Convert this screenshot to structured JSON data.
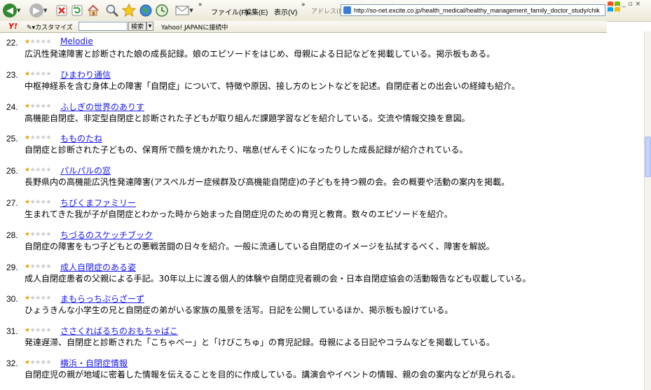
{
  "browser": {
    "menu": [
      "ファイル(F)",
      "編集(E)",
      "表示(V)"
    ],
    "address_label": "アドレス(D)",
    "url": "http://so-net.excite.co.jp/health_medical/healthy_management_family_doctor_study/chik",
    "colors": {
      "back": "#2f8a2f",
      "forward": "#b7b7b7",
      "accent": "#1a1ae6"
    }
  },
  "yahoo_bar": {
    "logo": "Y!",
    "customize": "カスタマイズ",
    "search_button": "検索",
    "connect_text": "Yahoo! JAPANに接続中"
  },
  "entries": [
    {
      "num": "22.",
      "rating": 1,
      "title": "Melodie",
      "desc": "広汎性発達障害と診断された娘の成長記録。娘のエピソードをはじめ、母親による日記などを掲載している。掲示板もある。"
    },
    {
      "num": "23.",
      "rating": 1,
      "title": "ひまわり通信",
      "desc": "中枢神経系を含む身体上の障害「自閉症」について、特徴や原因、接し方のヒントなどを記述。自閉症者との出会いの経緯も紹介。"
    },
    {
      "num": "24.",
      "rating": 1,
      "title": "ふしぎの世界のありす",
      "desc": "高機能自閉症、非定型自閉症と診断された子どもが取り組んだ課題学習などを紹介している。交流や情報交換を意図。"
    },
    {
      "num": "25.",
      "rating": 1,
      "title": "もものたね",
      "desc": "自閉症と診断された子どもの、保育所で顔を焼かれたり、喘息(ぜんそく)になったりした成長記録が紹介されている。"
    },
    {
      "num": "26.",
      "rating": 1,
      "title": "パルパルの窓",
      "desc": "長野県内の高機能広汎性発達障害(アスペルガー症候群及び高機能自閉症)の子どもを持つ親の会。会の概要や活動の案内を掲載。"
    },
    {
      "num": "27.",
      "rating": 1,
      "title": "ちびくまファミリー",
      "desc": "生まれてきた我が子が自閉症とわかった時から始まった自閉症児のための育児と教育。数々のエピソードを紹介。"
    },
    {
      "num": "28.",
      "rating": 1,
      "title": "ちづるのスケッチブック",
      "desc": "自閉症の障害をもつ子どもとの悪戦苦闘の日々を紹介。一般に流通している自閉症のイメージを払拭するべく、障害を解説。"
    },
    {
      "num": "29.",
      "rating": 1,
      "title": "成人自閉症のある姿",
      "desc": "成人自閉症患者の父親による手記。30年以上に渡る個人的体験や自閉症児者親の会・日本自閉症協会の活動報告なども収載している。"
    },
    {
      "num": "30.",
      "rating": 1,
      "title": "まもらっちぷらざーず",
      "desc": "ひょうきんな小学生の兄と自閉症の弟がいる家族の風景を活写。日記を公開しているほか、掲示板も設けている。"
    },
    {
      "num": "31.",
      "rating": 1,
      "title": "ささくればるちのおもちゃばこ",
      "desc": "発達遅滞、自閉症と診断された「こちゃべー」と「けびこちゅ」の育児記録。母親による日記やコラムなどを掲載している。"
    },
    {
      "num": "32.",
      "rating": 1,
      "title": "横浜・自閉症情報",
      "desc": "自閉症児の親が地域に密着した情報を伝えることを目的に作成している。講演会やイベントの情報、親の会の案内などが見られる。"
    }
  ]
}
